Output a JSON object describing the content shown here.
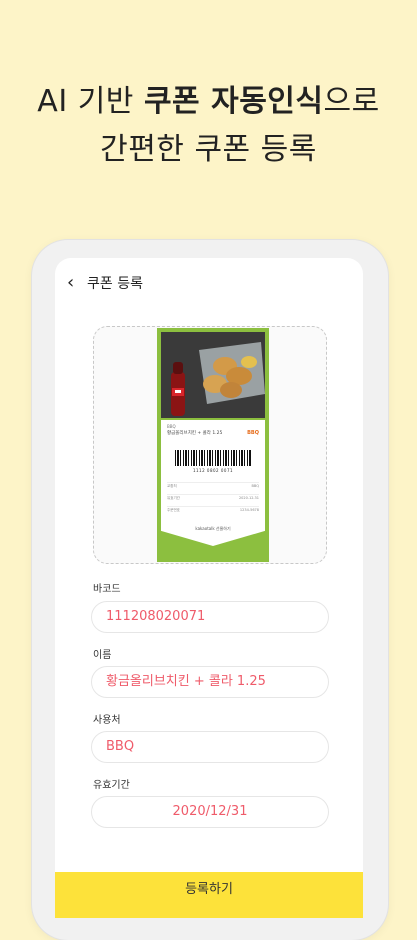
{
  "headline": {
    "line1_pre": "AI 기반 ",
    "line1_bold": "쿠폰 자동인식",
    "line1_post": "으로",
    "line2": "간편한 쿠폰 등록"
  },
  "screen": {
    "back_icon": "chevron-left-icon",
    "title": "쿠폰 등록"
  },
  "coupon_image": {
    "product_name": "황금올리브치킨 + 콜라 1.25",
    "logo_text": "BBQ",
    "barcode_number": "1112 0802 0071",
    "rows": [
      {
        "left": "교환처",
        "right": "BBQ"
      },
      {
        "left": "유효기간",
        "right": "2020.12.31"
      },
      {
        "left": "주문번호",
        "right": "1234-5678"
      }
    ],
    "footer": "kakaotalk 선물하기"
  },
  "form": {
    "barcode_label": "바코드",
    "barcode_value": "111208020071",
    "name_label": "이름",
    "name_value": "황금올리브치킨 + 콜라 1.25",
    "store_label": "사용처",
    "store_value": "BBQ",
    "expiry_label": "유효기간",
    "expiry_value": "2020/12/31"
  },
  "submit_label": "등록하기",
  "colors": {
    "background": "#fdf4c8",
    "accent_yellow": "#fde23a",
    "value_red": "#ef5b6a",
    "coupon_green": "#8cbf3f"
  }
}
